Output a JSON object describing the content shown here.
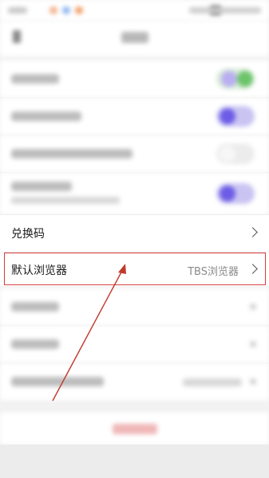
{
  "settings": {
    "redeem_code_label": "兑换码",
    "default_browser_label": "默认浏览器",
    "default_browser_value": "TBS浏览器"
  },
  "colors": {
    "highlight_border": "#d63a3a",
    "annotation_arrow": "#c0392b",
    "toggle_on": "#6c5ce7"
  }
}
